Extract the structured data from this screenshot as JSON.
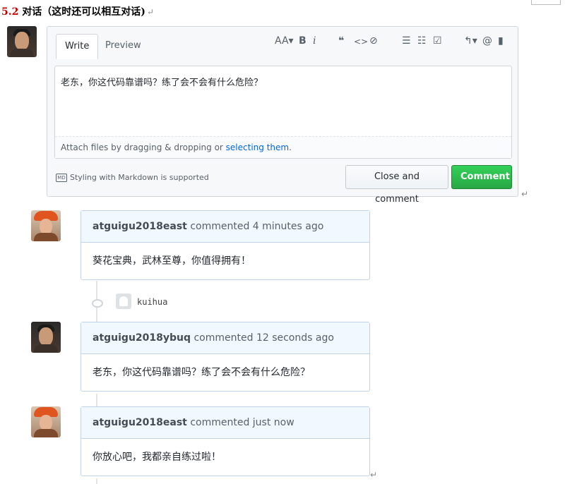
{
  "heading": {
    "number": "5.2",
    "title": "对话（这时还可以相互对话)",
    "return_mark": "↵"
  },
  "editor": {
    "tabs": [
      {
        "label": "Write",
        "active": true
      },
      {
        "label": "Preview",
        "active": false
      }
    ],
    "toolbar_icons": [
      "text-size-icon",
      "bold-icon",
      "italic-icon",
      "quote-icon",
      "code-icon",
      "link-icon",
      "bullet-list-icon",
      "numbered-list-icon",
      "task-list-icon",
      "reply-icon",
      "mention-icon",
      "bookmark-icon"
    ],
    "toolbar_glyphs": {
      "text_size": "AA▾",
      "bold": "B",
      "italic": "i",
      "quote": "❝",
      "code": "<>",
      "link": "⊘",
      "ul": "☰",
      "ol": "☷",
      "task": "☑",
      "reply": "↰▾",
      "mention": "@",
      "bookmark": "▮"
    },
    "textarea_value": "老东，你这代码靠谱吗？练了会不会有什么危险？",
    "attach_prefix": "Attach files by dragging & dropping or ",
    "attach_link": "selecting them",
    "attach_suffix": ".",
    "markdown_note": "Styling with Markdown is supported",
    "markdown_badge": "MD",
    "close_button": "Close and comment",
    "comment_button": "Comment",
    "return_mark": "↵"
  },
  "comments": [
    {
      "author": "atguigu2018east",
      "action": "commented",
      "time": "4 minutes ago",
      "body": "葵花宝典，武林至尊，你值得拥有！",
      "avatar": "warm"
    },
    {
      "author": "atguigu2018ybuq",
      "action": "commented",
      "time": "12 seconds ago",
      "body": "老东，你这代码靠谱吗？练了会不会有什么危险？",
      "avatar": "dark"
    },
    {
      "author": "atguigu2018east",
      "action": "commented",
      "time": "just now",
      "body": "你放心吧，我都亲自练过啦！",
      "avatar": "warm"
    }
  ],
  "timeline_event": {
    "label": "kuihua"
  },
  "end_mark": "↵",
  "colors": {
    "heading_number": "#c00000",
    "comment_green": "#28a745",
    "link_blue": "#0366d6",
    "comment_header_bg": "#f1f8ff"
  }
}
